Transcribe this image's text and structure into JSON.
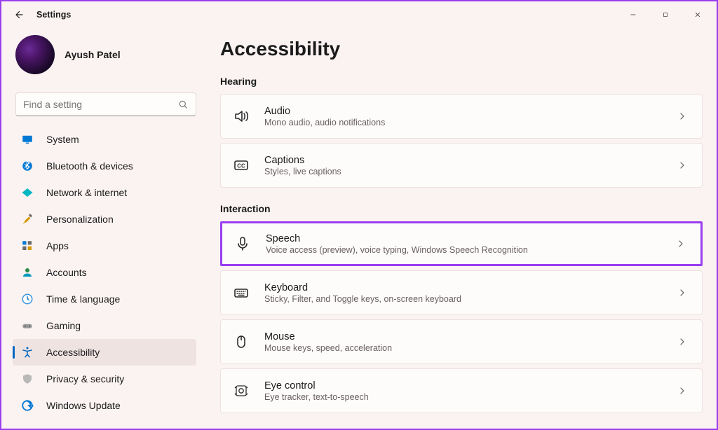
{
  "app_title": "Settings",
  "user": {
    "display_name": "Ayush Patel"
  },
  "search": {
    "placeholder": "Find a setting"
  },
  "nav": {
    "items": [
      {
        "label": "System",
        "icon": "monitor-icon",
        "selected": false
      },
      {
        "label": "Bluetooth & devices",
        "icon": "bluetooth-icon",
        "selected": false
      },
      {
        "label": "Network & internet",
        "icon": "wifi-icon",
        "selected": false
      },
      {
        "label": "Personalization",
        "icon": "paintbrush-icon",
        "selected": false
      },
      {
        "label": "Apps",
        "icon": "apps-icon",
        "selected": false
      },
      {
        "label": "Accounts",
        "icon": "person-icon",
        "selected": false
      },
      {
        "label": "Time & language",
        "icon": "clock-globe-icon",
        "selected": false
      },
      {
        "label": "Gaming",
        "icon": "gamepad-icon",
        "selected": false
      },
      {
        "label": "Accessibility",
        "icon": "accessibility-icon",
        "selected": true
      },
      {
        "label": "Privacy & security",
        "icon": "shield-icon",
        "selected": false
      },
      {
        "label": "Windows Update",
        "icon": "update-icon",
        "selected": false
      }
    ]
  },
  "page": {
    "title": "Accessibility",
    "sections": [
      {
        "label": "Hearing",
        "cards": [
          {
            "title": "Audio",
            "subtitle": "Mono audio, audio notifications",
            "icon": "speaker-icon",
            "highlighted": false
          },
          {
            "title": "Captions",
            "subtitle": "Styles, live captions",
            "icon": "cc-icon",
            "highlighted": false
          }
        ]
      },
      {
        "label": "Interaction",
        "cards": [
          {
            "title": "Speech",
            "subtitle": "Voice access (preview), voice typing, Windows Speech Recognition",
            "icon": "mic-icon",
            "highlighted": true
          },
          {
            "title": "Keyboard",
            "subtitle": "Sticky, Filter, and Toggle keys, on-screen keyboard",
            "icon": "keyboard-icon",
            "highlighted": false
          },
          {
            "title": "Mouse",
            "subtitle": "Mouse keys, speed, acceleration",
            "icon": "mouse-icon",
            "highlighted": false
          },
          {
            "title": "Eye control",
            "subtitle": "Eye tracker, text-to-speech",
            "icon": "eye-icon",
            "highlighted": false
          }
        ]
      }
    ]
  }
}
